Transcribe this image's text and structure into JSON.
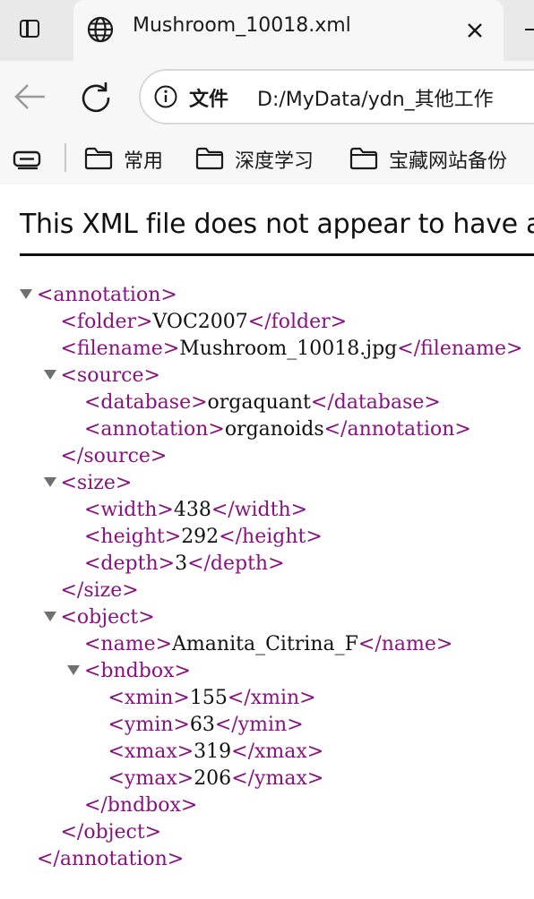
{
  "tab": {
    "title": "Mushroom_10018.xml"
  },
  "omnibox": {
    "security_label": "文件",
    "url": "D:/MyData/ydn_其他工作"
  },
  "bookmarks": [
    {
      "label": "常用"
    },
    {
      "label": "深度学习"
    },
    {
      "label": "宝藏网站备份"
    }
  ],
  "notice": "This XML file does not appear to have a",
  "xml": {
    "lines": [
      {
        "kind": "open",
        "tag": "<annotation>"
      },
      {
        "kind": "leaf",
        "open": "<folder>",
        "text": "VOC2007",
        "close": "</folder>"
      },
      {
        "kind": "leaf",
        "open": "<filename>",
        "text": "Mushroom_10018.jpg",
        "close": "</filename>"
      },
      {
        "kind": "open",
        "tag": "<source>"
      },
      {
        "kind": "leaf",
        "open": "<database>",
        "text": "orgaquant",
        "close": "</database>"
      },
      {
        "kind": "leaf",
        "open": "<annotation>",
        "text": "organoids",
        "close": "</annotation>"
      },
      {
        "kind": "close",
        "tag": "</source>"
      },
      {
        "kind": "open",
        "tag": "<size>"
      },
      {
        "kind": "leaf",
        "open": "<width>",
        "text": "438",
        "close": "</width>"
      },
      {
        "kind": "leaf",
        "open": "<height>",
        "text": "292",
        "close": "</height>"
      },
      {
        "kind": "leaf",
        "open": "<depth>",
        "text": "3",
        "close": "</depth>"
      },
      {
        "kind": "close",
        "tag": "</size>"
      },
      {
        "kind": "open",
        "tag": "<object>"
      },
      {
        "kind": "leaf",
        "open": "<name>",
        "text": "Amanita_Citrina_F",
        "close": "</name>"
      },
      {
        "kind": "open",
        "tag": "<bndbox>"
      },
      {
        "kind": "leaf",
        "open": "<xmin>",
        "text": "155",
        "close": "</xmin>"
      },
      {
        "kind": "leaf",
        "open": "<ymin>",
        "text": "63",
        "close": "</ymin>"
      },
      {
        "kind": "leaf",
        "open": "<xmax>",
        "text": "319",
        "close": "</xmax>"
      },
      {
        "kind": "leaf",
        "open": "<ymax>",
        "text": "206",
        "close": "</ymax>"
      },
      {
        "kind": "close",
        "tag": "</bndbox>"
      },
      {
        "kind": "close",
        "tag": "</object>"
      },
      {
        "kind": "close",
        "tag": "</annotation>"
      }
    ]
  }
}
